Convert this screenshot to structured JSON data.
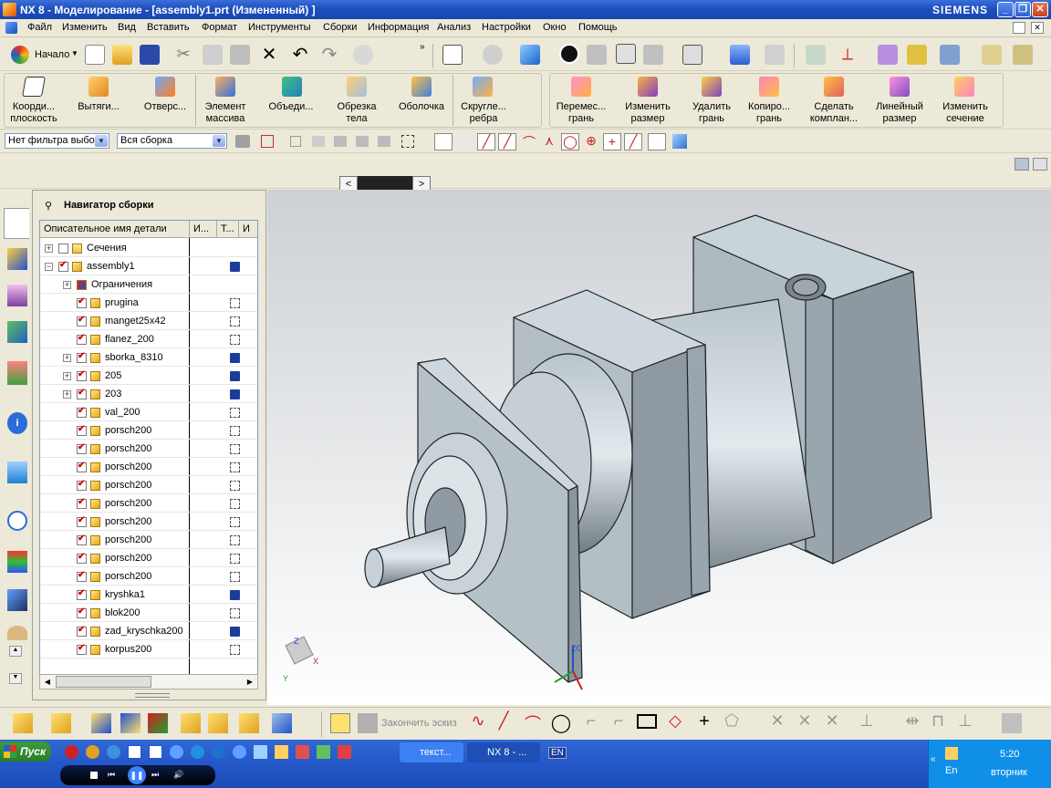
{
  "window": {
    "title": "NX 8 - Моделирование - [assembly1.prt (Измененный) ]",
    "brand": "SIEMENS"
  },
  "menu": [
    "Файл",
    "Изменить",
    "Вид",
    "Вставить",
    "Формат",
    "Инструменты",
    "Сборки",
    "Информация",
    "Анализ",
    "Настройки",
    "Окно",
    "Помощь"
  ],
  "toolbar_standard": {
    "start_label": "Начало"
  },
  "feature_tools_left": [
    "Коорди...\nплоскость",
    "Вытяги...",
    "Отверс...",
    "Элемент\nмассива",
    "Объеди...",
    "Обрезка\nтела",
    "Оболочка",
    "Скругле...\nребра"
  ],
  "feature_tools_right": [
    "Перемес...\nгрань",
    "Изменить\nразмер",
    "Удалить\nгрань",
    "Копиро...\nгрань",
    "Сделать\nкомплан...",
    "Линейный\nразмер",
    "Изменить\nсечение"
  ],
  "selection_bar": {
    "filter": "Нет фильтра выбо",
    "scope": "Вся сборка"
  },
  "navigator": {
    "title": "Навигатор сборки",
    "columns": [
      "Описательное имя детали",
      "И...",
      "Т...",
      "И"
    ],
    "rows": [
      {
        "name": "Сечения",
        "checked": false,
        "icon": "folder-icon",
        "expander": "+",
        "status": ""
      },
      {
        "name": "assembly1",
        "checked": true,
        "icon": "assembly-icon",
        "expander": "-",
        "status": "save"
      },
      {
        "name": "Ограничения",
        "checked": null,
        "icon": "constraints-icon",
        "expander": "+",
        "status": ""
      },
      {
        "name": "prugina",
        "checked": true,
        "icon": "part-icon",
        "expander": "",
        "status": "box"
      },
      {
        "name": "manget25x42",
        "checked": true,
        "icon": "part-icon",
        "expander": "",
        "status": "box"
      },
      {
        "name": "flanez_200",
        "checked": true,
        "icon": "part-icon",
        "expander": "",
        "status": "box"
      },
      {
        "name": "sborka_8310",
        "checked": true,
        "icon": "assembly-icon",
        "expander": "+",
        "status": "save"
      },
      {
        "name": "205",
        "checked": true,
        "icon": "assembly-icon",
        "expander": "+",
        "status": "save"
      },
      {
        "name": "203",
        "checked": true,
        "icon": "assembly-icon",
        "expander": "+",
        "status": "save"
      },
      {
        "name": "val_200",
        "checked": true,
        "icon": "part-icon",
        "expander": "",
        "status": "box"
      },
      {
        "name": "porsch200",
        "checked": true,
        "icon": "part-icon",
        "expander": "",
        "status": "box"
      },
      {
        "name": "porsch200",
        "checked": true,
        "icon": "part-icon",
        "expander": "",
        "status": "box"
      },
      {
        "name": "porsch200",
        "checked": true,
        "icon": "part-icon",
        "expander": "",
        "status": "box"
      },
      {
        "name": "porsch200",
        "checked": true,
        "icon": "part-icon",
        "expander": "",
        "status": "box"
      },
      {
        "name": "porsch200",
        "checked": true,
        "icon": "part-icon",
        "expander": "",
        "status": "box"
      },
      {
        "name": "porsch200",
        "checked": true,
        "icon": "part-icon",
        "expander": "",
        "status": "box"
      },
      {
        "name": "porsch200",
        "checked": true,
        "icon": "part-icon",
        "expander": "",
        "status": "box"
      },
      {
        "name": "porsch200",
        "checked": true,
        "icon": "part-icon",
        "expander": "",
        "status": "box"
      },
      {
        "name": "porsch200",
        "checked": true,
        "icon": "part-icon",
        "expander": "",
        "status": "box"
      },
      {
        "name": "kryshka1",
        "checked": true,
        "icon": "part-icon",
        "expander": "",
        "status": "save"
      },
      {
        "name": "blok200",
        "checked": true,
        "icon": "part-icon",
        "expander": "",
        "status": "box"
      },
      {
        "name": "zad_kryschka200",
        "checked": true,
        "icon": "part-icon",
        "expander": "",
        "status": "save"
      },
      {
        "name": "korpus200",
        "checked": true,
        "icon": "part-icon",
        "expander": "",
        "status": "box"
      }
    ]
  },
  "viewport": {
    "triad_zc": "ZC",
    "triad_z": "Z",
    "triad_y": "Y",
    "triad_x": "X"
  },
  "sketch_toolbar": {
    "finish_sketch": "Закончить эскиз"
  },
  "taskbar": {
    "start": "Пуск",
    "tasks": [
      "текст...",
      "NX 8 - ..."
    ],
    "lang": "EN",
    "time": "5:20",
    "day": "вторник",
    "tray_lang": "En"
  },
  "colors": {
    "titlebar": "#1f4fbf",
    "viewport_top": "#cdd1d5",
    "model": "#b8c4cc",
    "taskbar": "#2457c8"
  }
}
